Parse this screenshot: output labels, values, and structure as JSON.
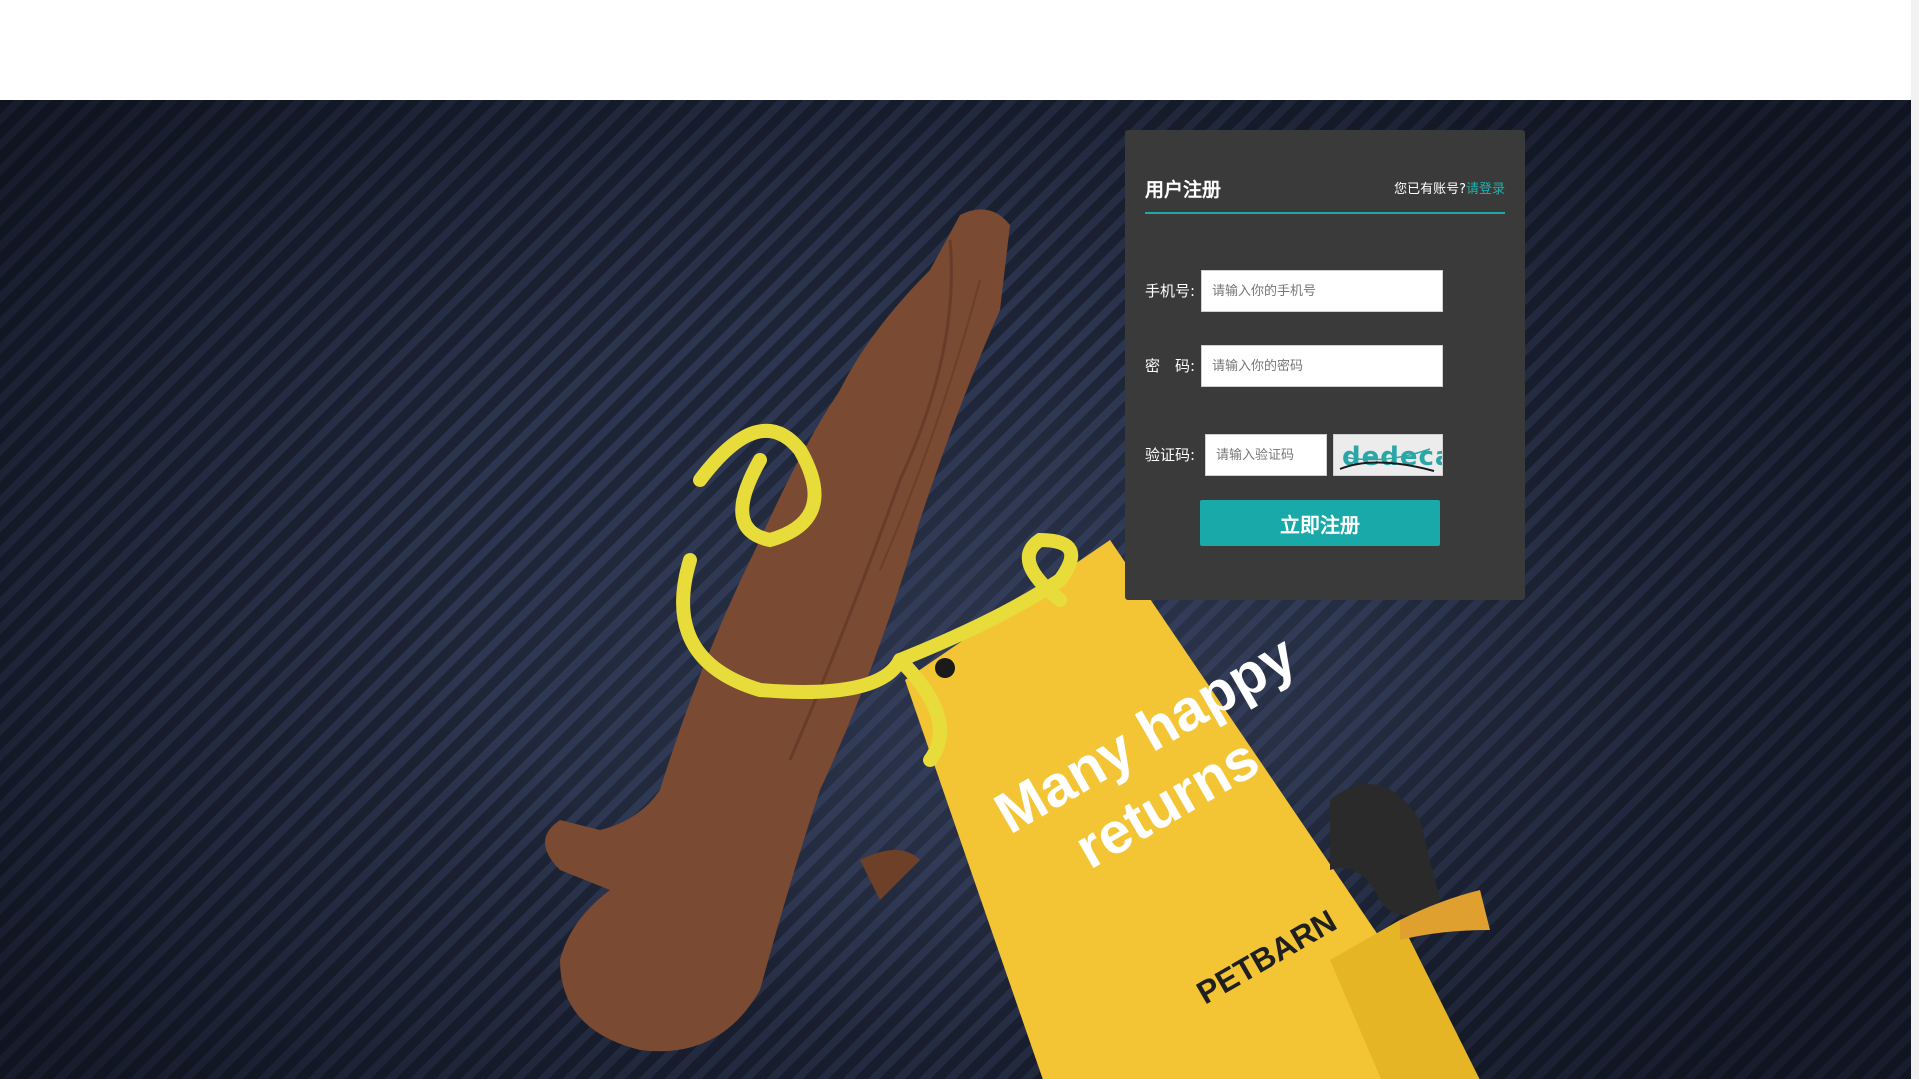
{
  "header": {},
  "hero": {
    "card_text_line1": "Many happy",
    "card_text_line2": "returns",
    "card_brand": "PETBARN"
  },
  "form": {
    "title": "用户注册",
    "login_prompt": "您已有账号?",
    "login_link": "请登录",
    "phone_label": "手机号:",
    "phone_placeholder": "请输入你的手机号",
    "password_label": "密　码:",
    "password_placeholder": "请输入你的密码",
    "captcha_label": "验证码:",
    "captcha_placeholder": "请输入验证码",
    "captcha_text": "dedeca",
    "submit_label": "立即注册"
  },
  "colors": {
    "accent": "#1aa9a9",
    "panel_bg": "#3a3a3a",
    "card_yellow": "#f2c230",
    "stick_brown": "#7a4a32",
    "ribbon_yellow": "#e8dc3a"
  }
}
